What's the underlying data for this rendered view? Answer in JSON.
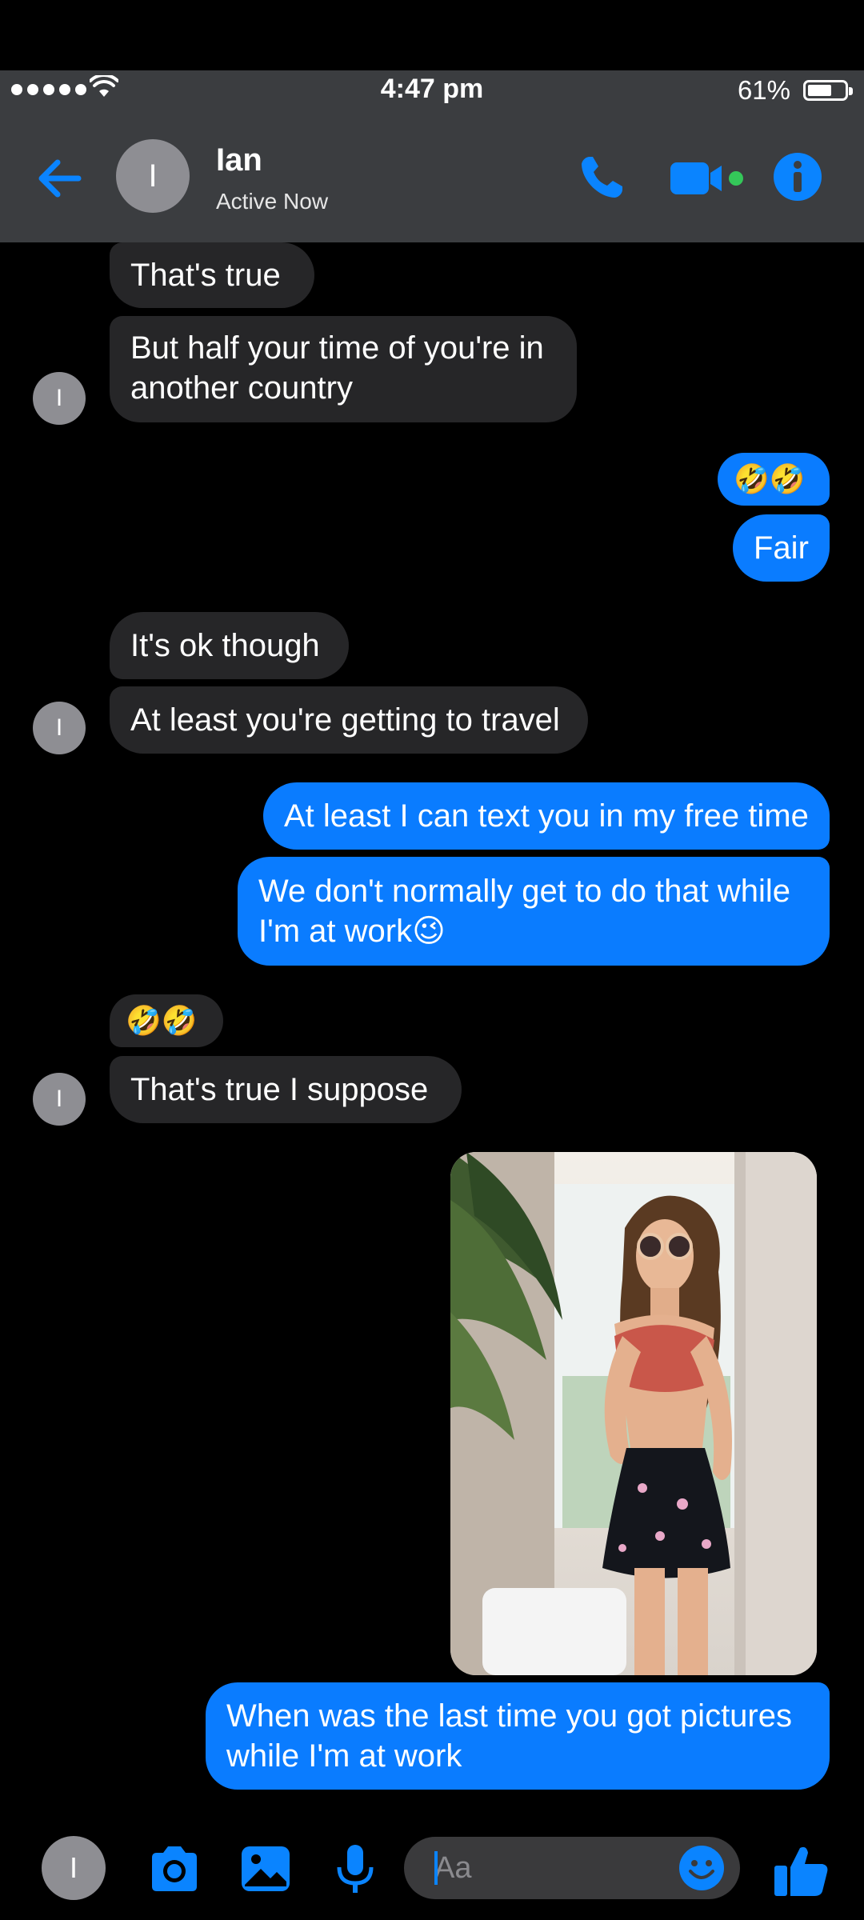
{
  "status_bar": {
    "time": "4:47 pm",
    "battery": "61%"
  },
  "header": {
    "contact_name": "Ian",
    "status": "Active Now",
    "avatar_initial": "I"
  },
  "messages": [
    {
      "side": "in",
      "text": "That's true"
    },
    {
      "side": "in",
      "text": "But half your time of you're in\nanother country"
    },
    {
      "side": "out",
      "text": "🤣🤣"
    },
    {
      "side": "out",
      "text": "Fair"
    },
    {
      "side": "in",
      "text": "It's ok though"
    },
    {
      "side": "in",
      "text": "At least you're getting to travel"
    },
    {
      "side": "out",
      "text": "At least I can text you in my free time"
    },
    {
      "side": "out",
      "text": "We don't normally get to do that while\nI'm at work😉"
    },
    {
      "side": "in",
      "text": "🤣🤣"
    },
    {
      "side": "in",
      "text": "That's true I suppose"
    },
    {
      "side": "out",
      "type": "photo"
    },
    {
      "side": "out",
      "text": "When was the last time you got pictures\nwhile I'm at work"
    }
  ],
  "composer": {
    "placeholder": "Aa"
  },
  "colors": {
    "accent": "#0a7cff",
    "incoming_bubble": "#262628",
    "header_bg": "#3b3d40",
    "online": "#34c759"
  },
  "icons": {
    "back": "arrow-left-icon",
    "call": "phone-icon",
    "video": "video-camera-icon",
    "info": "info-icon",
    "camera": "camera-icon",
    "gallery": "image-icon",
    "mic": "microphone-icon",
    "emoji": "smiley-icon",
    "like": "thumbs-up-icon"
  }
}
